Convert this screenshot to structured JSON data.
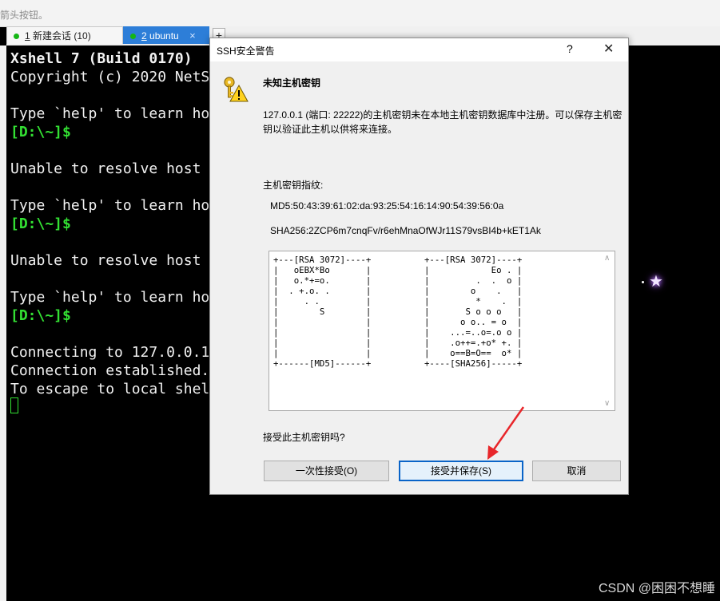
{
  "top_tip": "箭头按钮。",
  "tabs": [
    {
      "num": "1",
      "label": "新建会话 (10)",
      "close": "×"
    },
    {
      "num": "2",
      "label": "ubuntu",
      "close": "×"
    }
  ],
  "new_tab_label": "+",
  "terminal": {
    "lines": [
      "Xshell 7 (Build 0170)",
      "Copyright (c) 2020 NetS",
      "Type `help' to learn ho",
      "[D:\\~]$",
      "Unable to resolve host",
      "Type `help' to learn ho",
      "[D:\\~]$",
      "Unable to resolve host",
      "Type `help' to learn ho",
      "[D:\\~]$",
      "Connecting to 127.0.0.1",
      "Connection established.",
      "To escape to local shel"
    ]
  },
  "dialog": {
    "title": "SSH安全警告",
    "help": "?",
    "close": "✕",
    "heading": "未知主机密钥",
    "description": "127.0.0.1 (端口: 22222)的主机密钥未在本地主机密钥数据库中注册。可以保存主机密钥以验证此主机以供将来连接。",
    "fingerprint_label": "主机密钥指纹:",
    "md5": "MD5:50:43:39:61:02:da:93:25:54:16:14:90:54:39:56:0a",
    "sha256": "SHA256:2ZCP6m7cnqFv/r6ehMnaOfWJr11S79vsBI4b+kET1Ak",
    "randomart_md5": "+---[RSA 3072]----+\n|   oEBX*Bo       |\n|   o.*+=o.       |\n|  . +.o. .       |\n|     . .         |\n|        S        |\n|                 |\n|                 |\n|                 |\n|                 |\n+------[MD5]------+",
    "randomart_sha256": "+---[RSA 3072]----+\n|            Eo . |\n|         .  .  o |\n|        o    .   |\n|         *    .  |\n|       S o o o   |\n|      o o.. = o  |\n|    ...=..o=.o o |\n|    .o++=.+o* +. |\n|    o==B=O==  o* |\n+----[SHA256]-----+",
    "question": "接受此主机密钥吗?",
    "buttons": {
      "accept_once": "一次性接受(O)",
      "accept_save": "接受并保存(S)",
      "cancel": "取消"
    }
  },
  "watermark": "CSDN @困困不想睡",
  "colors": {
    "tab_active": "#2d7ed8",
    "status_dot": "#14b614",
    "prompt_green": "#33e033",
    "annotation_arrow": "#e8262a"
  }
}
